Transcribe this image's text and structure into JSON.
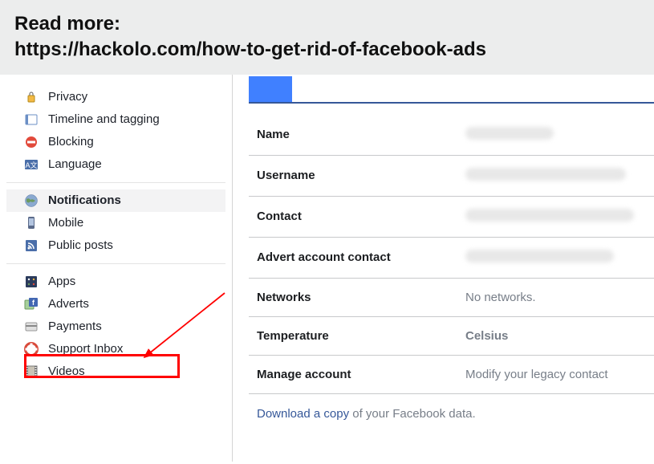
{
  "banner": {
    "line1": "Read more:",
    "line2": "https://hackolo.com/how-to-get-rid-of-facebook-ads"
  },
  "sidebar": {
    "group1": [
      {
        "label": "Privacy",
        "icon": "privacy-icon"
      },
      {
        "label": "Timeline and tagging",
        "icon": "timeline-icon"
      },
      {
        "label": "Blocking",
        "icon": "blocking-icon"
      },
      {
        "label": "Language",
        "icon": "language-icon"
      }
    ],
    "group2": [
      {
        "label": "Notifications",
        "icon": "globe-icon",
        "selected": true
      },
      {
        "label": "Mobile",
        "icon": "mobile-icon"
      },
      {
        "label": "Public posts",
        "icon": "rss-icon"
      }
    ],
    "group3": [
      {
        "label": "Apps",
        "icon": "apps-icon"
      },
      {
        "label": "Adverts",
        "icon": "adverts-icon",
        "highlighted": true
      },
      {
        "label": "Payments",
        "icon": "payments-icon"
      },
      {
        "label": "Support Inbox",
        "icon": "support-icon"
      },
      {
        "label": "Videos",
        "icon": "videos-icon"
      }
    ]
  },
  "content": {
    "rows": [
      {
        "label": "Name",
        "value_blurred": true
      },
      {
        "label": "Username",
        "value_blurred": true
      },
      {
        "label": "Contact",
        "value_blurred": true
      },
      {
        "label": "Advert account contact",
        "value_blurred": true
      },
      {
        "label": "Networks",
        "value": "No networks."
      },
      {
        "label": "Temperature",
        "value": "Celsius"
      },
      {
        "label": "Manage account",
        "value": "Modify your legacy contact "
      }
    ],
    "download_prefix": "Download a copy",
    "download_suffix": " of your Facebook data."
  }
}
